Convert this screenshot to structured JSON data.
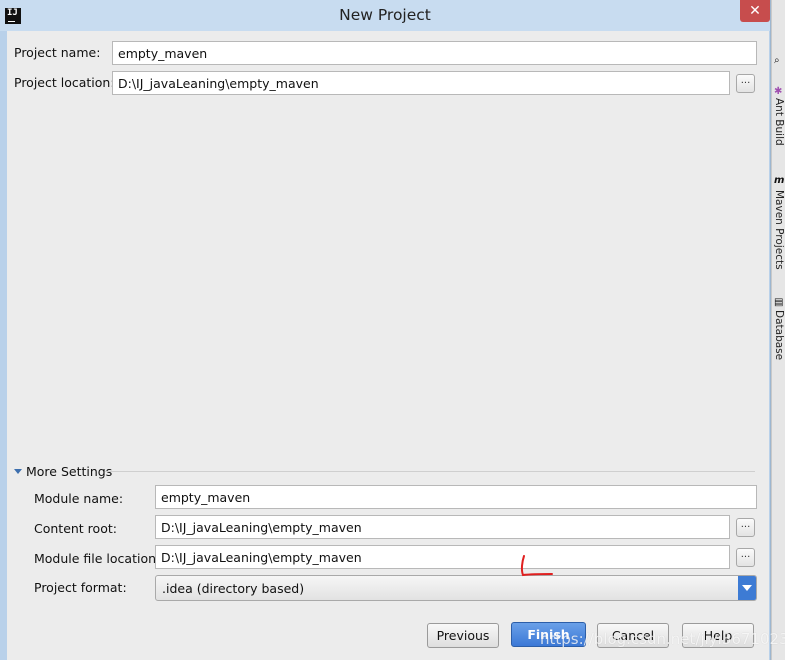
{
  "window": {
    "title": "New Project",
    "app_icon_text": "IJ",
    "close_glyph": "✕"
  },
  "form": {
    "project_name_label": "Project name:",
    "project_name_value": "empty_maven",
    "project_location_label": "Project location:",
    "project_location_value": "D:\\IJ_javaLeaning\\empty_maven",
    "browse_glyph": "..."
  },
  "more_settings": {
    "label": "More Settings",
    "module_name_label": "Module name:",
    "module_name_value": "empty_maven",
    "content_root_label": "Content root:",
    "content_root_value": "D:\\IJ_javaLeaning\\empty_maven",
    "module_file_location_label": "Module file location:",
    "module_file_location_value": "D:\\IJ_javaLeaning\\empty_maven",
    "project_format_label": "Project format:",
    "project_format_value": ".idea (directory based)"
  },
  "buttons": {
    "previous": "Previous",
    "finish": "Finish",
    "cancel": "Cancel",
    "help": "Help"
  },
  "side_tools": {
    "ant_build": "Ant Build",
    "maven_projects": "Maven Projects",
    "database": "Database"
  },
  "watermark": "https://blog.csdn.net/jiyi3671023",
  "colors": {
    "accent": "#3b78d6",
    "annotation": "#e02020",
    "title_bar": "#c8dcf0"
  }
}
